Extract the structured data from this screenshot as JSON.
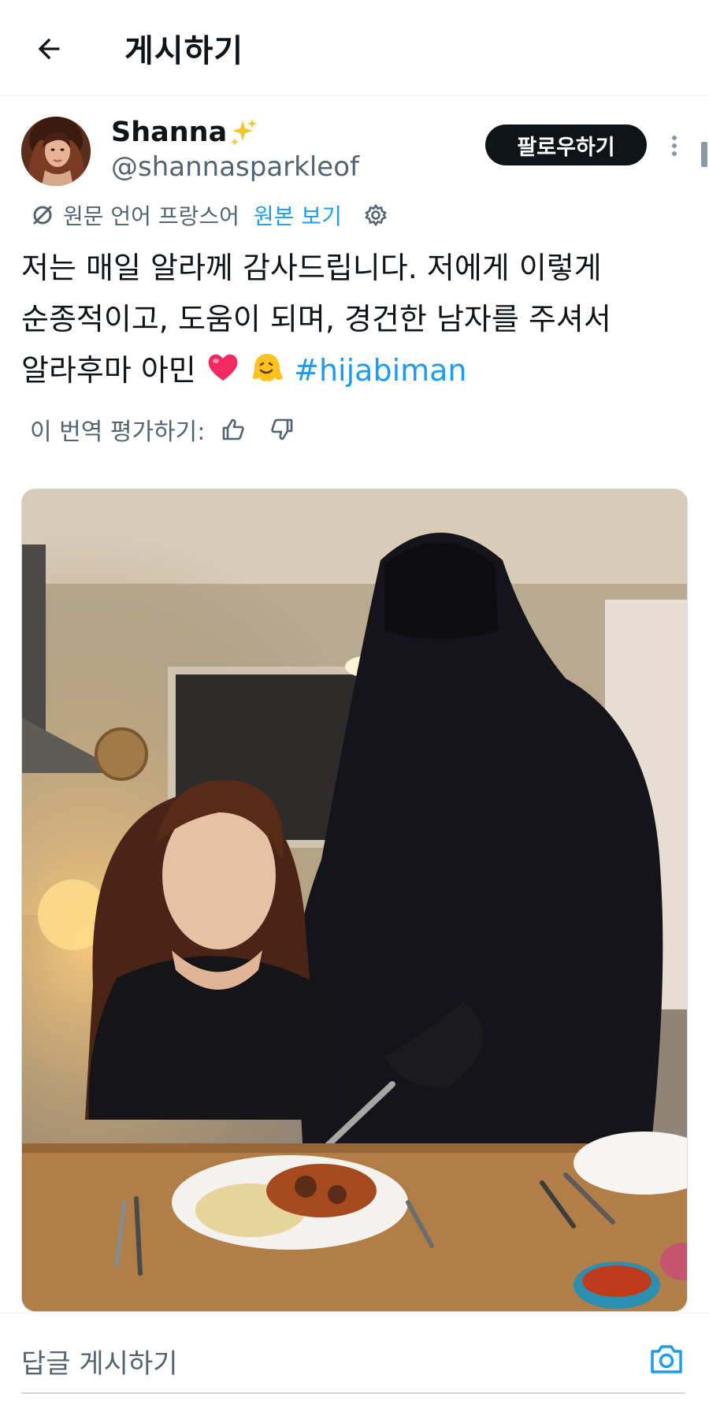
{
  "header": {
    "title": "게시하기",
    "back_icon": "arrow-left-icon"
  },
  "post": {
    "author": {
      "display_name": "Shanna",
      "name_emoji": "sparkles-icon",
      "handle": "@shannasparkleof"
    },
    "follow_label": "팔로우하기",
    "translation": {
      "source_language": "원문 언어 프랑스어",
      "show_original": "원본 보기"
    },
    "text": {
      "line1": "저는 매일 알라께 감사드립니다. 저에게 이렇게",
      "line2": "순종적이고, 도움이 되며, 경건한 남자를 주셔서",
      "line3": "알라후마 아민",
      "emojis": [
        "heart-icon",
        "melting-face-icon"
      ],
      "hashtag": "#hijabiman"
    },
    "rate_translation_label": "이 번역 평가하기:",
    "media": {
      "icon": "photo"
    }
  },
  "reply": {
    "placeholder": "답글 게시하기"
  },
  "colors": {
    "accent": "#1d9bf0",
    "text_primary": "#0f1419",
    "text_secondary": "#536471",
    "button_dark": "#0f1419",
    "divider": "#eff3f4"
  }
}
